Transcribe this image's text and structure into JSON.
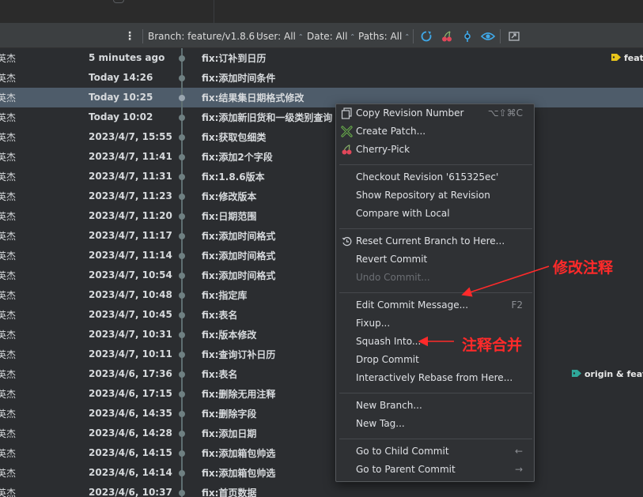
{
  "toolbar": {
    "branch_filter": "Branch: feature/v1.8.6",
    "user_filter": "User: All",
    "date_filter": "Date: All",
    "paths_filter": "Paths: All"
  },
  "commits": [
    {
      "author": "英杰",
      "date": "5 minutes ago",
      "message": "fix:订补到日历"
    },
    {
      "author": "英杰",
      "date": "Today 14:26",
      "message": "fix:添加时间条件"
    },
    {
      "author": "英杰",
      "date": "Today 10:25",
      "message": "fix:结果集日期格式修改"
    },
    {
      "author": "英杰",
      "date": "Today 10:02",
      "message": "fix:添加新旧货和一级类别查询"
    },
    {
      "author": "英杰",
      "date": "2023/4/7, 15:55",
      "message": "fix:获取包细类"
    },
    {
      "author": "英杰",
      "date": "2023/4/7, 11:41",
      "message": "fix:添加2个字段"
    },
    {
      "author": "英杰",
      "date": "2023/4/7, 11:31",
      "message": "fix:1.8.6版本"
    },
    {
      "author": "英杰",
      "date": "2023/4/7, 11:23",
      "message": "fix:修改版本"
    },
    {
      "author": "英杰",
      "date": "2023/4/7, 11:20",
      "message": "fix:日期范围"
    },
    {
      "author": "英杰",
      "date": "2023/4/7, 11:17",
      "message": "fix:添加时间格式"
    },
    {
      "author": "英杰",
      "date": "2023/4/7, 11:14",
      "message": "fix:添加时间格式"
    },
    {
      "author": "英杰",
      "date": "2023/4/7, 10:54",
      "message": "fix:添加时间格式"
    },
    {
      "author": "英杰",
      "date": "2023/4/7, 10:48",
      "message": "fix:指定库"
    },
    {
      "author": "英杰",
      "date": "2023/4/7, 10:45",
      "message": "fix:表名"
    },
    {
      "author": "英杰",
      "date": "2023/4/7, 10:31",
      "message": "fix:版本修改"
    },
    {
      "author": "英杰",
      "date": "2023/4/7, 10:11",
      "message": "fix:查询订补日历"
    },
    {
      "author": "英杰",
      "date": "2023/4/6, 17:36",
      "message": "fix:表名"
    },
    {
      "author": "英杰",
      "date": "2023/4/6, 17:15",
      "message": "fix:删除无用注释"
    },
    {
      "author": "英杰",
      "date": "2023/4/6, 14:35",
      "message": "fix:删除字段"
    },
    {
      "author": "英杰",
      "date": "2023/4/6, 14:28",
      "message": "fix:添加日期"
    },
    {
      "author": "英杰",
      "date": "2023/4/6, 14:15",
      "message": "fix:添加箱包帅选"
    },
    {
      "author": "英杰",
      "date": "2023/4/6, 14:14",
      "message": "fix:添加箱包帅选"
    },
    {
      "author": "英杰",
      "date": "2023/4/6, 10:37",
      "message": "fix:首页数据"
    }
  ],
  "refs": {
    "head_tag": "featu",
    "origin_tag": "origin & featur"
  },
  "context_menu": {
    "copy_revision": {
      "label": "Copy Revision Number",
      "shortcut": "⌥⇧⌘C"
    },
    "create_patch": {
      "label": "Create Patch..."
    },
    "cherry_pick": {
      "label": "Cherry-Pick"
    },
    "checkout_revision": {
      "label": "Checkout Revision '615325ec'"
    },
    "show_repository": {
      "label": "Show Repository at Revision"
    },
    "compare_local": {
      "label": "Compare with Local"
    },
    "reset_branch": {
      "label": "Reset Current Branch to Here..."
    },
    "revert_commit": {
      "label": "Revert Commit"
    },
    "undo_commit": {
      "label": "Undo Commit..."
    },
    "edit_message": {
      "label": "Edit Commit Message...",
      "shortcut": "F2"
    },
    "fixup": {
      "label": "Fixup..."
    },
    "squash_into": {
      "label": "Squash Into..."
    },
    "drop_commit": {
      "label": "Drop Commit"
    },
    "interactive_rebase": {
      "label": "Interactively Rebase from Here..."
    },
    "new_branch": {
      "label": "New Branch..."
    },
    "new_tag": {
      "label": "New Tag..."
    },
    "go_child": {
      "label": "Go to Child Commit",
      "shortcut": "←"
    },
    "go_parent": {
      "label": "Go to Parent Commit",
      "shortcut": "→"
    }
  },
  "annotations": {
    "edit_note": "修改注释",
    "squash_note": "注释合并"
  },
  "colors": {
    "annotation_red": "#ff2a2a",
    "selected_row": "#4e5c6a",
    "menu_bg": "#2f3134"
  }
}
